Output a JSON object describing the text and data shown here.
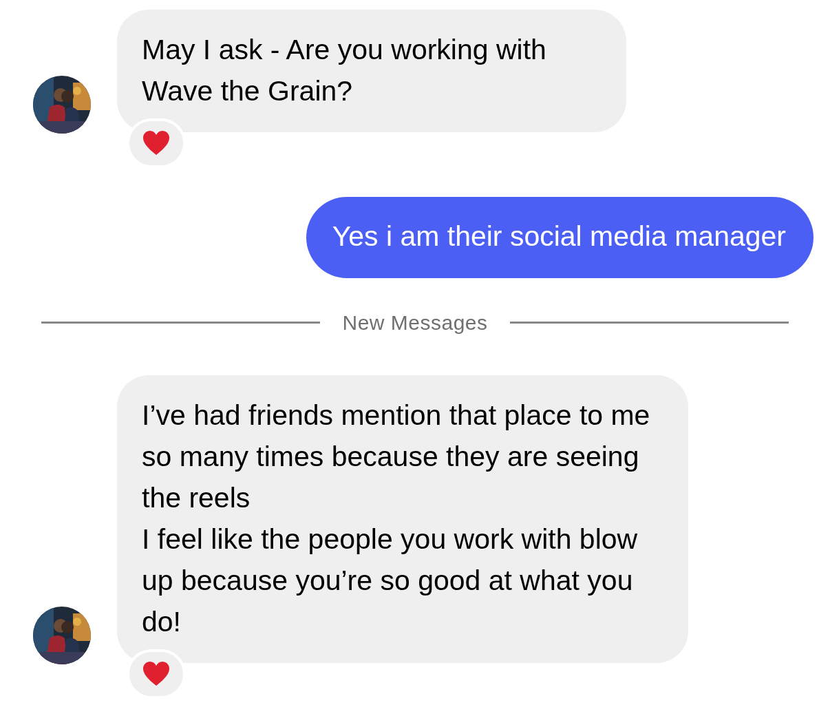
{
  "messages": [
    {
      "kind": "incoming",
      "texts": [
        "May I ask - Are you working with Wave the Grain?"
      ],
      "avatar": true,
      "reacted": true
    },
    {
      "kind": "outgoing",
      "texts": [
        "Yes i am their social media manager"
      ]
    },
    {
      "kind": "divider",
      "texts": [
        "New Messages"
      ]
    },
    {
      "kind": "incoming",
      "texts": [
        "I’ve had friends mention that place to me so many times because they are seeing the reels",
        "I feel like the people you work with blow up because you’re so good at what you do!"
      ],
      "avatar": true,
      "reacted": true
    }
  ]
}
